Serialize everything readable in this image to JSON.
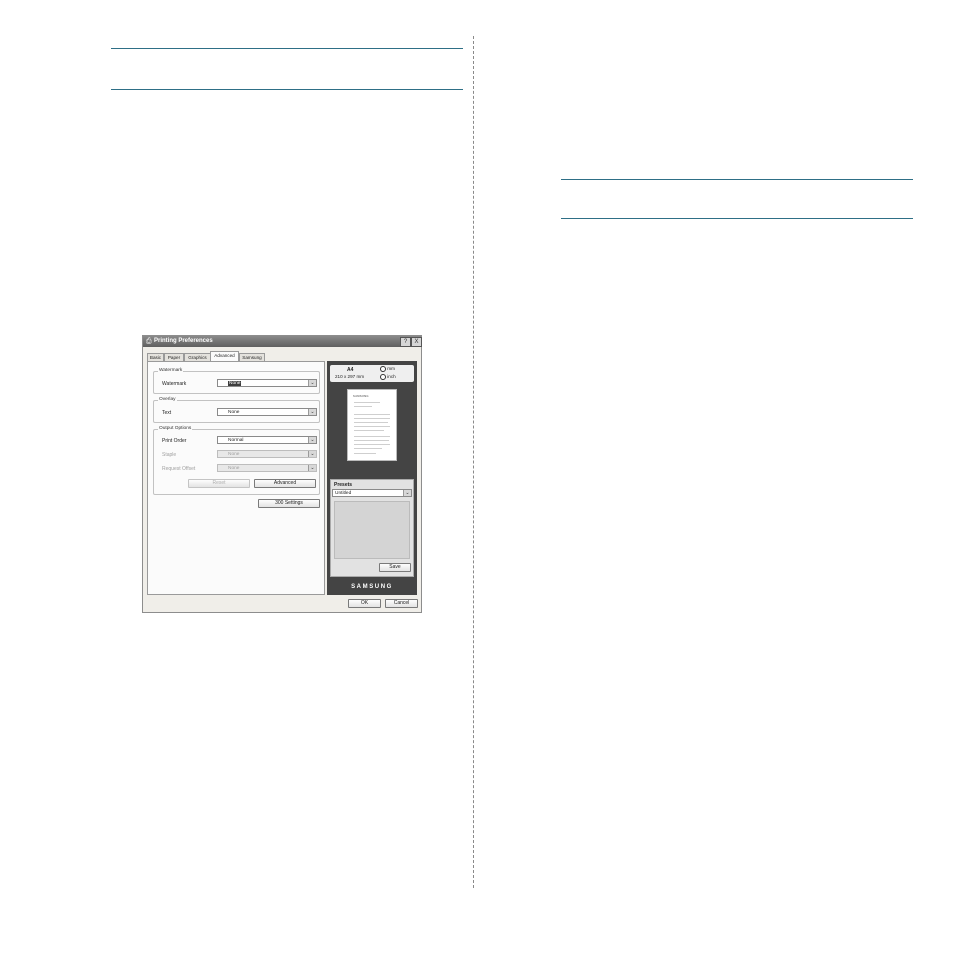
{
  "dialog": {
    "title": "Printing Preferences",
    "help_button": "?",
    "close_button": "X",
    "tabs": [
      {
        "label": "Basic"
      },
      {
        "label": "Paper"
      },
      {
        "label": "Graphics"
      },
      {
        "label": "Advanced",
        "active": true
      },
      {
        "label": "Samsung"
      }
    ],
    "watermark": {
      "group_label": "Watermark",
      "field_label": "Watermark",
      "value": "None"
    },
    "overlay": {
      "group_label": "Overlay",
      "field_label": "Text",
      "value": "None"
    },
    "output_options": {
      "group_label": "Output Options",
      "print_order_label": "Print Order",
      "print_order_value": "Normal",
      "staple_label": "Staple",
      "staple_value": "None",
      "request_offset_label": "Request Offset",
      "request_offset_value": "None",
      "reset_button": "Reset",
      "advanced_button": "Advanced"
    },
    "settings_button": "300 Settings",
    "preview": {
      "paper_size": "A4",
      "paper_dimensions": "210 x 297 mm",
      "unit_mm": "mm",
      "unit_inch": "inch",
      "paper_logo_text": "SAMSUNG"
    },
    "presets": {
      "label": "Presets",
      "value": "Untitled",
      "save_button": "Save"
    },
    "brand": "SAMSUNG",
    "ok_button": "OK",
    "cancel_button": "Cancel"
  }
}
